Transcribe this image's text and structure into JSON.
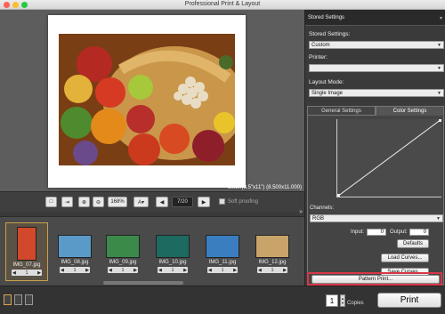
{
  "window": {
    "title": "Professional Print & Layout",
    "traffic_light_colors": [
      "#ff5f57",
      "#febc2e",
      "#28c840"
    ]
  },
  "preview": {
    "paper_size": "Letter(8.5\"x11\") (8.500x11.000)"
  },
  "toolbar": {
    "zoom": "168%",
    "page": "7/20",
    "soft_proofing": "Soft proofing"
  },
  "thumbnails": [
    {
      "name": "IMG_07.jpg",
      "count": "1",
      "selected": true,
      "color": "#d2482a"
    },
    {
      "name": "IMG_08.jpg",
      "count": "1",
      "selected": false,
      "color": "#5a9ac8"
    },
    {
      "name": "IMG_09.jpg",
      "count": "1",
      "selected": false,
      "color": "#3b8a4a"
    },
    {
      "name": "IMG_10.jpg",
      "count": "1",
      "selected": false,
      "color": "#1c6a60"
    },
    {
      "name": "IMG_11.jpg",
      "count": "1",
      "selected": false,
      "color": "#3a7ec0"
    },
    {
      "name": "IMG_12.jpg",
      "count": "1",
      "selected": false,
      "color": "#c8a46a"
    }
  ],
  "bottom": {
    "copies_value": "1",
    "copies_label": "Copies",
    "print_label": "Print"
  },
  "panel": {
    "header": "Stored Settings",
    "stored_settings_label": "Stored Settings:",
    "stored_settings_value": "Custom",
    "printer_label": "Printer:",
    "printer_value": "",
    "layout_mode_label": "Layout Mode:",
    "layout_mode_value": "Single Image",
    "tabs": [
      "General Settings",
      "Color Settings"
    ],
    "active_tab": "Color Settings",
    "channels_label": "Channels:",
    "channels_value": "RGB",
    "input_label": "Input:",
    "input_value": "0",
    "output_label": "Output:",
    "output_value": "0",
    "defaults_button": "Defaults",
    "load_curves_button": "Load Curves...",
    "save_curves_button": "Save Curves...",
    "pattern_print_button": "Pattern Print...",
    "highlight_color": "#d9364a"
  }
}
